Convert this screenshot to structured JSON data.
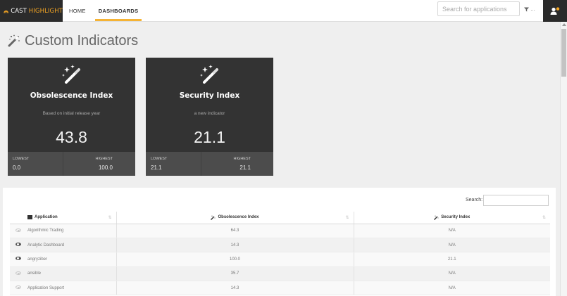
{
  "brand": {
    "name_part1": "CAST",
    "name_part2": "HIGHLIGHT",
    "accent": "#f5a623"
  },
  "nav": [
    {
      "label": "HOME",
      "active": false
    },
    {
      "label": "DASHBOARDS",
      "active": true
    }
  ],
  "search": {
    "placeholder": "Search for applications"
  },
  "filter": {
    "label": "…"
  },
  "page": {
    "title": "Custom Indicators",
    "title_icon": "magic-wand-icon"
  },
  "cards": [
    {
      "title": "Obsolescence Index",
      "subtitle": "Based on initial release year",
      "value": "43.8",
      "lowest_label": "LOWEST",
      "lowest": "0.0",
      "highest_label": "HIGHEST",
      "highest": "100.0"
    },
    {
      "title": "Security Index",
      "subtitle": "a new indicator",
      "value": "21.1",
      "lowest_label": "LOWEST",
      "lowest": "21.1",
      "highest_label": "HIGHEST",
      "highest": "21.1"
    }
  ],
  "table": {
    "search_label": "Search:",
    "columns": [
      "Application",
      "Obsolescence Index",
      "Security Index"
    ],
    "rows": [
      {
        "eye": "dim",
        "app": "Algorithmic Trading",
        "obsolescence": "64.3",
        "security": "N/A"
      },
      {
        "eye": "dark",
        "app": "Analytic Dashboard",
        "obsolescence": "14.3",
        "security": "N/A"
      },
      {
        "eye": "dark",
        "app": "angryziber",
        "obsolescence": "100.0",
        "security": "21.1"
      },
      {
        "eye": "dim",
        "app": "ansible",
        "obsolescence": "35.7",
        "security": "N/A"
      },
      {
        "eye": "dim",
        "app": "Application Support",
        "obsolescence": "14.3",
        "security": "N/A"
      }
    ]
  }
}
